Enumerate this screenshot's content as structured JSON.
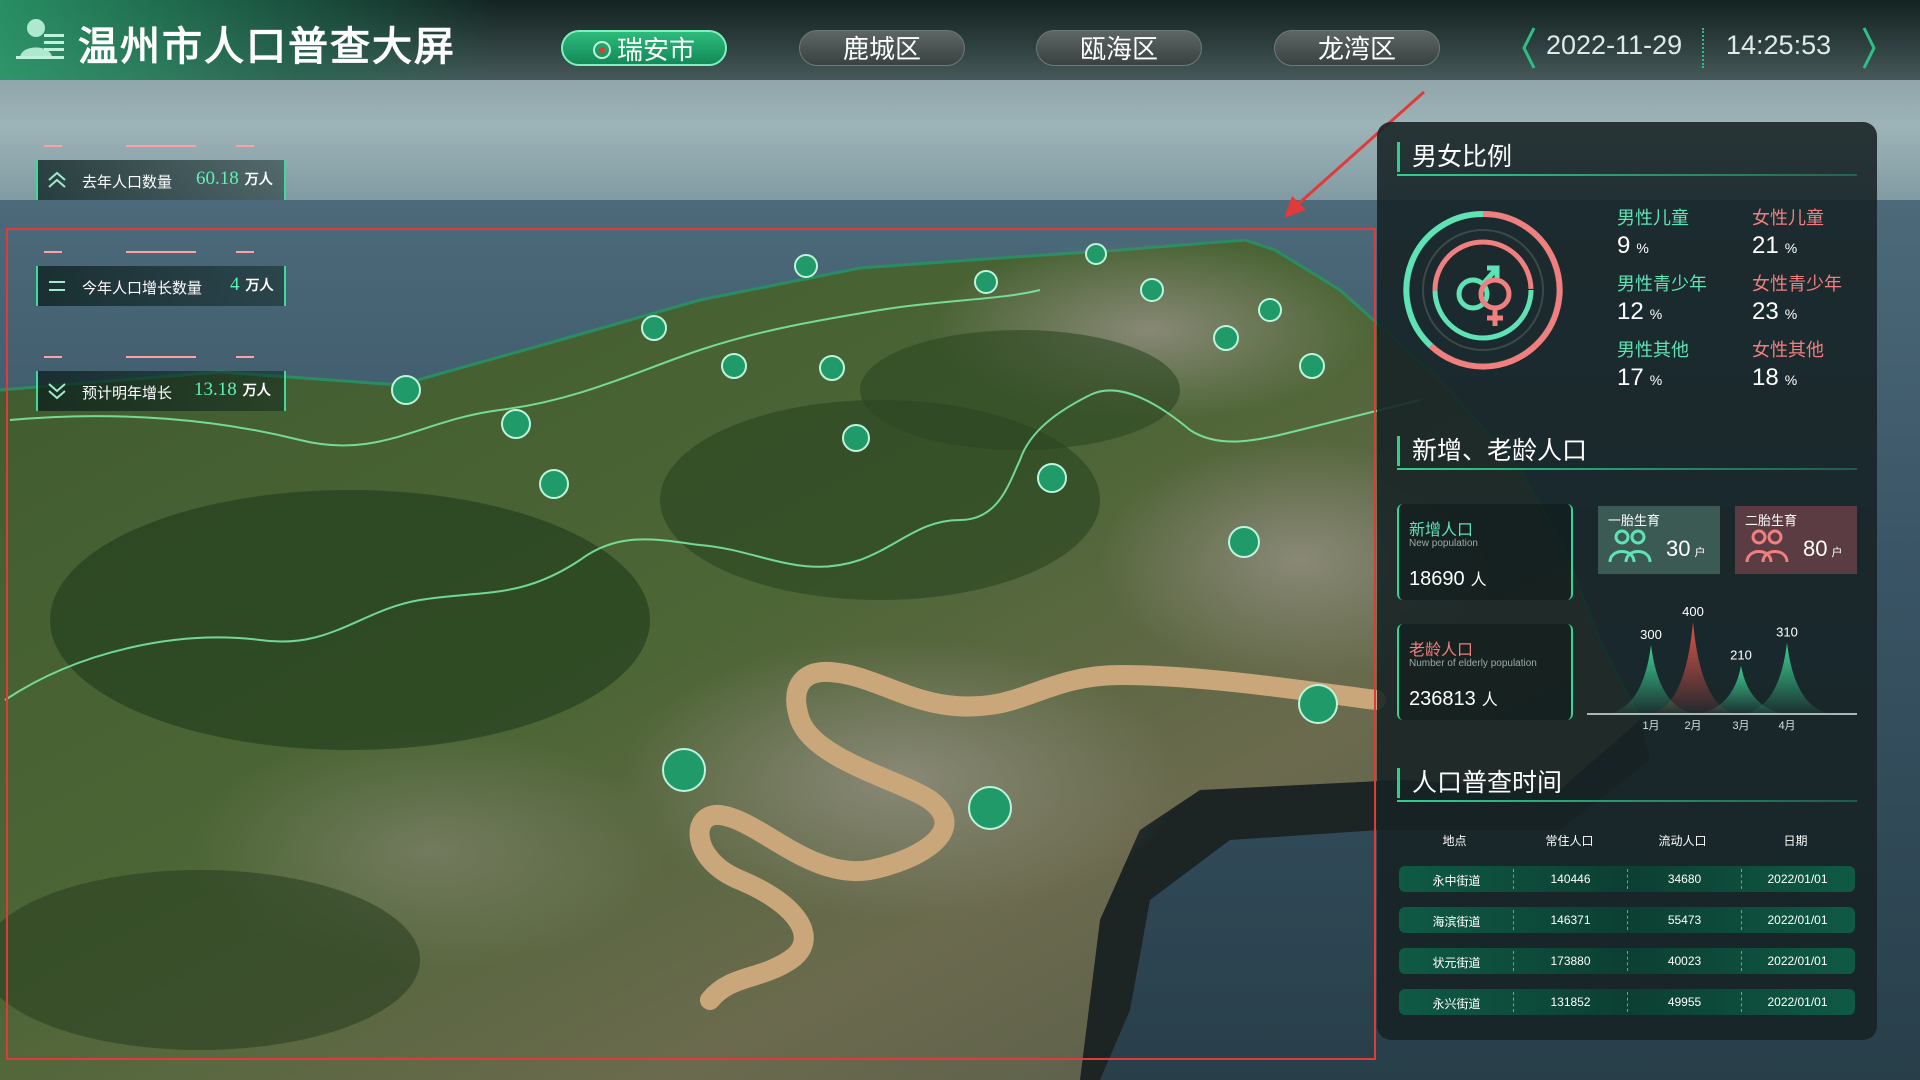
{
  "header": {
    "title": "温州市人口普查大屏",
    "tabs": [
      {
        "label": "瑞安市",
        "active": true
      },
      {
        "label": "鹿城区",
        "active": false
      },
      {
        "label": "瓯海区",
        "active": false
      },
      {
        "label": "龙湾区",
        "active": false
      }
    ],
    "date": "2022-11-29",
    "time": "14:25:53"
  },
  "stats": [
    {
      "label": "去年人口数量",
      "value": "60.18",
      "unit": "万人",
      "icon": "chevron-up-icon"
    },
    {
      "label": "今年人口增长数量",
      "value": "4",
      "unit": "万人",
      "icon": "equals-icon"
    },
    {
      "label": "预计明年增长",
      "value": "13.18",
      "unit": "万人",
      "icon": "chevron-down-icon"
    }
  ],
  "gender": {
    "title": "男女比例",
    "icon": "gender-symbol-icon",
    "items": [
      {
        "label": "男性儿童",
        "value": "9",
        "unit": "%",
        "sex": "male"
      },
      {
        "label": "女性儿童",
        "value": "21",
        "unit": "%",
        "sex": "female"
      },
      {
        "label": "男性青少年",
        "value": "12",
        "unit": "%",
        "sex": "male"
      },
      {
        "label": "女性青少年",
        "value": "23",
        "unit": "%",
        "sex": "female"
      },
      {
        "label": "男性其他",
        "value": "17",
        "unit": "%",
        "sex": "male"
      },
      {
        "label": "女性其他",
        "value": "18",
        "unit": "%",
        "sex": "female"
      }
    ]
  },
  "population": {
    "title": "新增、老龄人口",
    "new": {
      "label": "新增人口",
      "en": "New population",
      "value": "18690",
      "unit": "人"
    },
    "elderly": {
      "label": "老龄人口",
      "en": "Number of elderly population",
      "value": "236813",
      "unit": "人"
    },
    "first_birth": {
      "label": "一胎生育",
      "value": "30",
      "unit": "户"
    },
    "second_birth": {
      "label": "二胎生育",
      "value": "80",
      "unit": "户"
    }
  },
  "chart_data": {
    "type": "area",
    "categories": [
      "1月",
      "2月",
      "3月",
      "4月"
    ],
    "values": [
      300,
      400,
      210,
      310
    ],
    "colors": [
      "#3fd99a",
      "#e8554d",
      "#3fd99a",
      "#3fd99a"
    ],
    "title": "",
    "xlabel": "",
    "ylabel": ""
  },
  "census": {
    "title": "人口普查时间",
    "columns": [
      "地点",
      "常住人口",
      "流动人口",
      "日期"
    ],
    "rows": [
      [
        "永中街道",
        "140446",
        "34680",
        "2022/01/01"
      ],
      [
        "海滨街道",
        "146371",
        "55473",
        "2022/01/01"
      ],
      [
        "状元街道",
        "173880",
        "40023",
        "2022/01/01"
      ],
      [
        "永兴街道",
        "131852",
        "49955",
        "2022/01/01"
      ]
    ]
  },
  "colors": {
    "accent": "#2fd08e",
    "male": "#5fe3b5",
    "female": "#f07f7f",
    "annotation": "#e03a3a"
  }
}
